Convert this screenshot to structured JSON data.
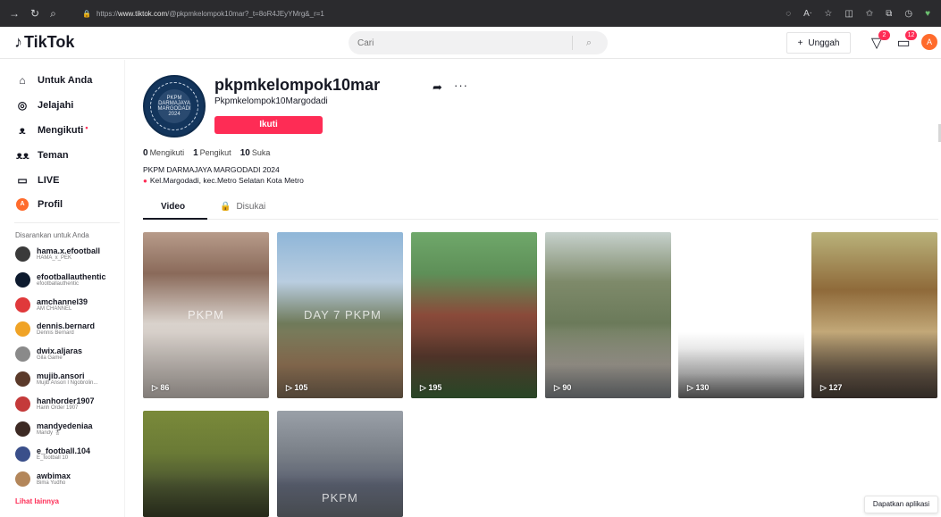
{
  "browser": {
    "url_host": "www.tiktok.com",
    "url_rest": "/@pkpmkelompok10mar?_t=8oR4JEyYMrg&_r=1",
    "url_prefix": "https://"
  },
  "header": {
    "logo_text": "TikTok",
    "search_placeholder": "Cari",
    "upload_label": "Unggah",
    "inbox_badge": "2",
    "messages_badge": "12",
    "avatar_letter": "A"
  },
  "sidebar": {
    "items": [
      {
        "label": "Untuk Anda",
        "icon": "home-icon"
      },
      {
        "label": "Jelajahi",
        "icon": "compass-icon"
      },
      {
        "label": "Mengikuti",
        "icon": "following-icon"
      },
      {
        "label": "Teman",
        "icon": "friends-icon"
      },
      {
        "label": "LIVE",
        "icon": "live-icon"
      },
      {
        "label": "Profil",
        "icon": "profile-icon",
        "avatar_letter": "A"
      }
    ],
    "suggested_title": "Disarankan untuk Anda",
    "suggested": [
      {
        "username": "hama.x.efootball",
        "name": "HAMA_x_PEK",
        "color": "#3a3a3a"
      },
      {
        "username": "efootballauthentic",
        "name": "efootballauthentic",
        "color": "#0d1a2e"
      },
      {
        "username": "amchannel39",
        "name": "AM CHANNEL",
        "color": "#e0393b"
      },
      {
        "username": "dennis.bernard",
        "name": "Dennis Bernard",
        "color": "#f0a326"
      },
      {
        "username": "dwix.aljaras",
        "name": "Gila Game",
        "color": "#8a8a8a"
      },
      {
        "username": "mujib.ansori",
        "name": "Mujib Ansori I Ngobrolin...",
        "color": "#5b3a2a"
      },
      {
        "username": "hanhorder1907",
        "name": "Hanh Order 1907",
        "color": "#c43a3a"
      },
      {
        "username": "mandyedeniaa",
        "name": "Mandy 🎖",
        "color": "#3d2a24"
      },
      {
        "username": "e_football.104",
        "name": "E_football 10",
        "color": "#3a4f8a"
      },
      {
        "username": "awbimax",
        "name": "Bima Yudho",
        "color": "#b3865a"
      }
    ],
    "see_more": "Lihat lainnya"
  },
  "profile": {
    "username": "pkpmkelompok10mar",
    "display_name": "Pkpmkelompok10Margodadi",
    "follow_label": "Ikuti",
    "following_count": "0",
    "following_label": "Mengikuti",
    "followers_count": "1",
    "followers_label": "Pengikut",
    "likes_count": "10",
    "likes_label": "Suka",
    "bio_line1": "PKPM DARMAJAYA MARGODADI 2024",
    "bio_line2": "Kel.Margodadi, kec.Metro Selatan Kota Metro",
    "avatar_text": "PKPM DARMAJAYA MARGODADI 2024"
  },
  "tabs": [
    {
      "label": "Video",
      "active": true
    },
    {
      "label": "Disukai",
      "active": false
    }
  ],
  "videos": [
    {
      "views": "86",
      "watermark": "PKPM"
    },
    {
      "views": "105",
      "watermark": "DAY 7 PKPM"
    },
    {
      "views": "195",
      "watermark": ""
    },
    {
      "views": "90",
      "watermark": ""
    },
    {
      "views": "130",
      "watermark": ""
    },
    {
      "views": "127",
      "watermark": ""
    },
    {
      "views": "",
      "watermark": ""
    },
    {
      "views": "",
      "watermark": "PKPM"
    }
  ],
  "get_app_label": "Dapatkan aplikasi"
}
